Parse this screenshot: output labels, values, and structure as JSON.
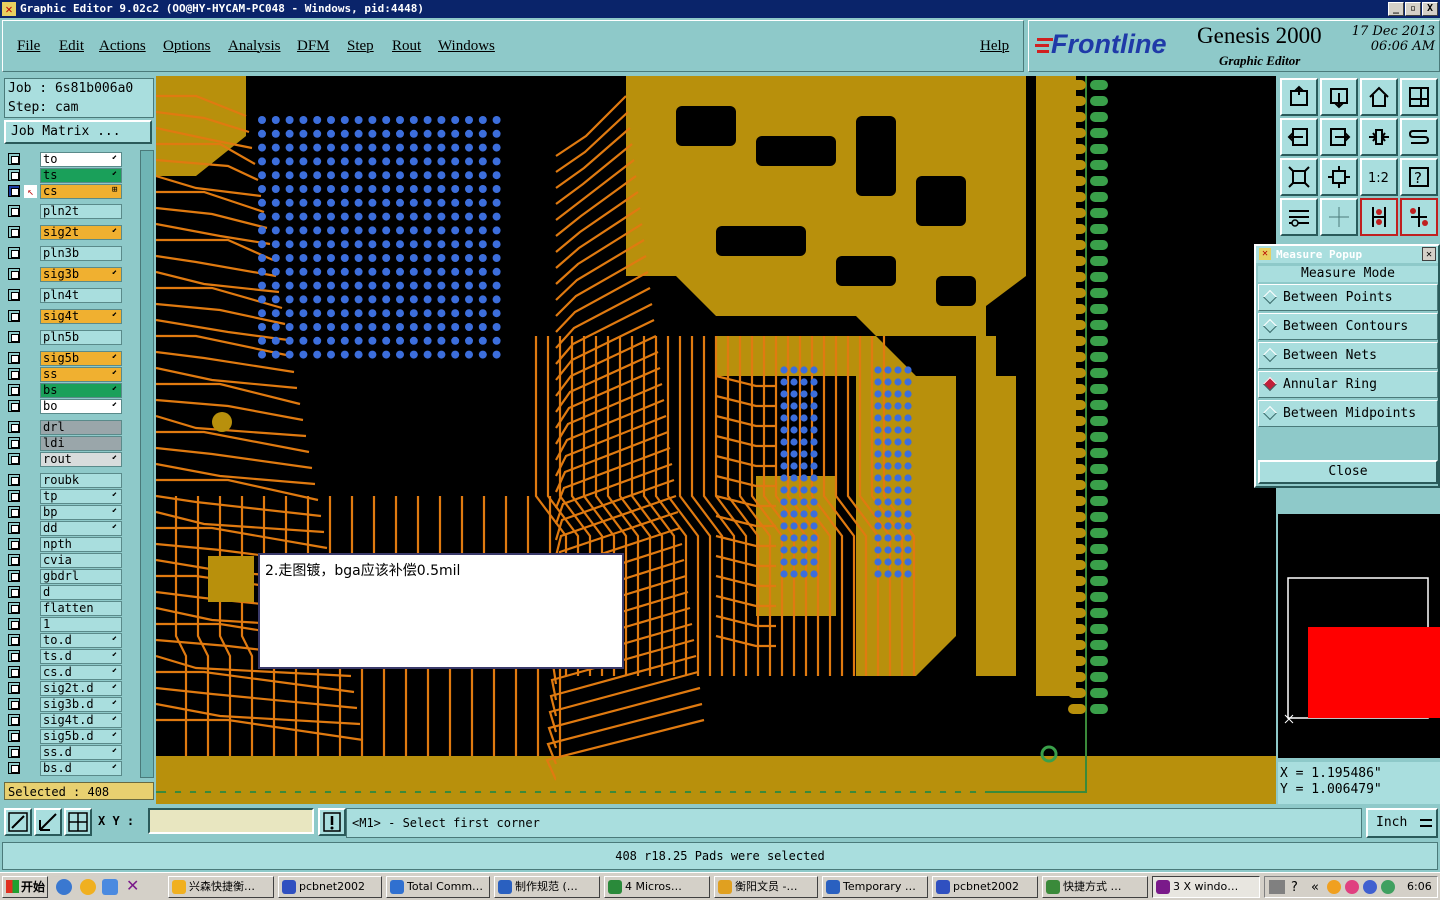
{
  "titlebar": {
    "title": "Graphic Editor 9.02c2 (OO@HY-HYCAM-PC048 - Windows, pid:4448)",
    "min": "_",
    "max": "▫",
    "close": "X"
  },
  "menu": {
    "items": [
      "File",
      "Edit",
      "Actions",
      "Options",
      "Analysis",
      "DFM",
      "Step",
      "Rout",
      "Windows"
    ],
    "help": "Help"
  },
  "brand": {
    "logo": "Frontline",
    "product": "Genesis 2000",
    "subtitle": "Graphic Editor",
    "date": "17 Dec 2013",
    "time": "06:06 AM"
  },
  "job": {
    "job_line": "Job : 6s81b006a0",
    "step_line": "Step: cam",
    "matrix_button": "Job Matrix ..."
  },
  "layers": [
    {
      "name": "to",
      "color": "#ffffff",
      "arrow": "⬋"
    },
    {
      "name": "ts",
      "color": "#1aa05a",
      "arrow": "⬋"
    },
    {
      "name": "cs",
      "color": "#f0b030",
      "arrow": "⊞",
      "active": true
    },
    {
      "name": "pln2t",
      "color": "#a9dede",
      "arrow": ""
    },
    {
      "name": "sig2t",
      "color": "#f0b030",
      "arrow": "⬋"
    },
    {
      "name": "pln3b",
      "color": "#a9dede",
      "arrow": ""
    },
    {
      "name": "sig3b",
      "color": "#f0b030",
      "arrow": "⬋"
    },
    {
      "name": "pln4t",
      "color": "#a9dede",
      "arrow": ""
    },
    {
      "name": "sig4t",
      "color": "#f0b030",
      "arrow": "⬋"
    },
    {
      "name": "pln5b",
      "color": "#a9dede",
      "arrow": ""
    },
    {
      "name": "sig5b",
      "color": "#f0b030",
      "arrow": "⬋"
    },
    {
      "name": "ss",
      "color": "#f0b030",
      "arrow": "⬋"
    },
    {
      "name": "bs",
      "color": "#1aa05a",
      "arrow": "⬋"
    },
    {
      "name": "bo",
      "color": "#ffffff",
      "arrow": "⬋"
    },
    {
      "name": "drl",
      "color": "#9aa6aa",
      "arrow": ""
    },
    {
      "name": "ldi",
      "color": "#9aa6aa",
      "arrow": ""
    },
    {
      "name": "rout",
      "color": "#d8dcdc",
      "arrow": "⬋"
    },
    {
      "name": "roubk",
      "color": "#a9dede",
      "arrow": ""
    },
    {
      "name": "tp",
      "color": "#a9dede",
      "arrow": "⬋"
    },
    {
      "name": "bp",
      "color": "#a9dede",
      "arrow": "⬋"
    },
    {
      "name": "dd",
      "color": "#a9dede",
      "arrow": "⬋"
    },
    {
      "name": "npth",
      "color": "#a9dede",
      "arrow": ""
    },
    {
      "name": "cvia",
      "color": "#a9dede",
      "arrow": ""
    },
    {
      "name": "gbdrl",
      "color": "#a9dede",
      "arrow": ""
    },
    {
      "name": "d",
      "color": "#a9dede",
      "arrow": ""
    },
    {
      "name": "flatten",
      "color": "#a9dede",
      "arrow": ""
    },
    {
      "name": "1",
      "color": "#a9dede",
      "arrow": ""
    },
    {
      "name": "to.d",
      "color": "#a9dede",
      "arrow": "⬋"
    },
    {
      "name": "ts.d",
      "color": "#a9dede",
      "arrow": "⬋"
    },
    {
      "name": "cs.d",
      "color": "#a9dede",
      "arrow": "⬋"
    },
    {
      "name": "sig2t.d",
      "color": "#a9dede",
      "arrow": "⬋"
    },
    {
      "name": "sig3b.d",
      "color": "#a9dede",
      "arrow": "⬋"
    },
    {
      "name": "sig4t.d",
      "color": "#a9dede",
      "arrow": "⬋"
    },
    {
      "name": "sig5b.d",
      "color": "#a9dede",
      "arrow": "⬋"
    },
    {
      "name": "ss.d",
      "color": "#a9dede",
      "arrow": "⬋"
    },
    {
      "name": "bs.d",
      "color": "#a9dede",
      "arrow": "⬋"
    }
  ],
  "selected": "Selected : 408",
  "note": "2.走图镀，bga应该补偿0.5mil",
  "measure": {
    "title": "Measure Popup",
    "heading": "Measure Mode",
    "options": [
      "Between Points",
      "Between Contours",
      "Between Nets",
      "Annular Ring",
      "Between Midpoints"
    ],
    "selected_option": "Annular Ring",
    "close": "Close"
  },
  "coords": {
    "x": "X = 1.195486\"",
    "y": "Y = 1.006479\""
  },
  "cmd": {
    "xy_label": "X Y :",
    "xy_value": "",
    "prompt": "<M1> - Select first corner",
    "unit": "Inch"
  },
  "status": "408 r18.25 Pads were selected",
  "taskbar": {
    "start": "开始",
    "tasks": [
      "兴森快捷衡…",
      "pcbnet2002",
      "Total Comm…",
      "制作规范 (…",
      "4 Micros…",
      "衡阳文员 -…",
      "Temporary …",
      "pcbnet2002",
      "快捷方式 …",
      "3 X windo…"
    ],
    "clock": "6:06"
  },
  "colors": {
    "copper": "#b8900c",
    "trace": "#e07a10",
    "pad": "#3c6edc",
    "board": "#000000",
    "accent_red": "#ff0000"
  }
}
